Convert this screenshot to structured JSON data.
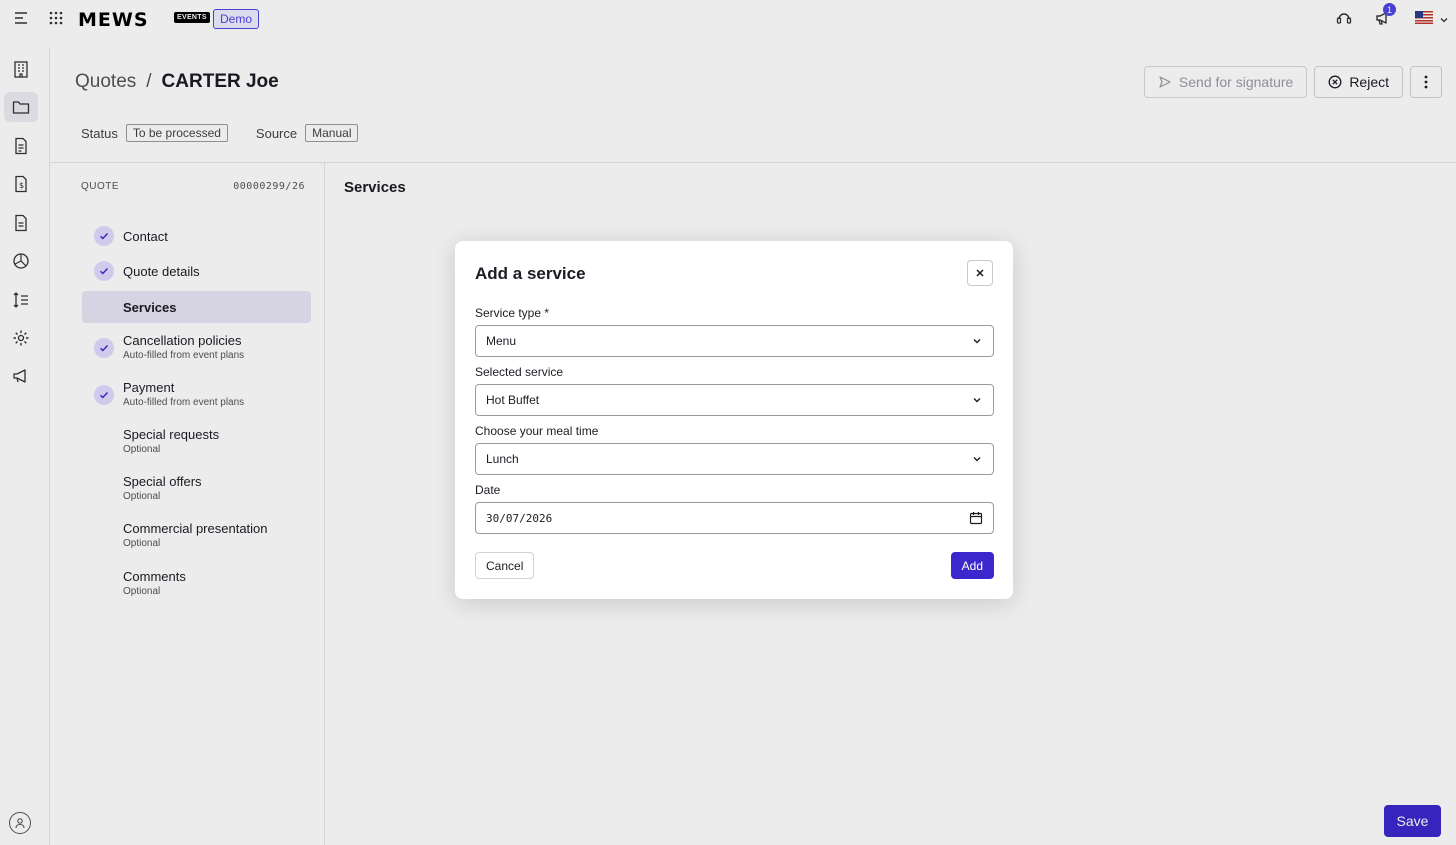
{
  "topbar": {
    "logo": "MEWS",
    "logo_badge": "EVENTS",
    "env_badge": "Demo",
    "notification_count": "1"
  },
  "header": {
    "breadcrumb_parent": "Quotes",
    "breadcrumb_separator": "/",
    "breadcrumb_current": "CARTER Joe",
    "send_for_signature_label": "Send for signature",
    "reject_label": "Reject"
  },
  "status": {
    "status_label": "Status",
    "status_value": "To be processed",
    "source_label": "Source",
    "source_value": "Manual"
  },
  "stepper": {
    "heading": "QUOTE",
    "quote_number": "00000299/26",
    "steps": [
      {
        "label": "Contact",
        "sub": "",
        "done": true
      },
      {
        "label": "Quote details",
        "sub": "",
        "done": true
      },
      {
        "label": "Services",
        "sub": "",
        "active": true
      },
      {
        "label": "Cancellation policies",
        "sub": "Auto-filled from event plans",
        "done": true
      },
      {
        "label": "Payment",
        "sub": "Auto-filled from event plans",
        "done": true
      },
      {
        "label": "Special requests",
        "sub": "Optional"
      },
      {
        "label": "Special offers",
        "sub": "Optional"
      },
      {
        "label": "Commercial presentation",
        "sub": "Optional"
      },
      {
        "label": "Comments",
        "sub": "Optional"
      }
    ]
  },
  "main": {
    "section_title": "Services",
    "save_label": "Save"
  },
  "modal": {
    "title": "Add a service",
    "service_type_label": "Service type *",
    "service_type_value": "Menu",
    "selected_service_label": "Selected service",
    "selected_service_value": "Hot Buffet",
    "meal_time_label": "Choose your meal time",
    "meal_time_value": "Lunch",
    "date_label": "Date",
    "date_value": "30/07/2026",
    "cancel_label": "Cancel",
    "add_label": "Add"
  },
  "colors": {
    "accent": "#3b28cc",
    "check_bg": "#e1dcff",
    "active_step_bg": "#e8e6f5"
  }
}
